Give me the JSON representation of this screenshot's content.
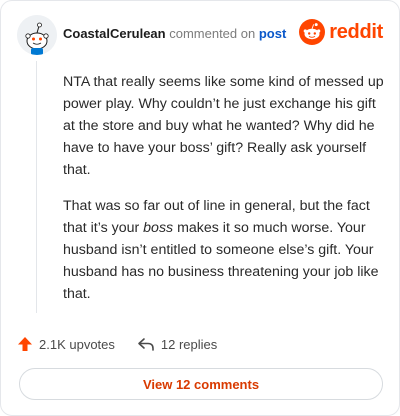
{
  "header": {
    "username": "CoastalCerulean",
    "commented_on": "commented on",
    "post_link": "post"
  },
  "brand": {
    "name": "reddit",
    "color": "#ff4500"
  },
  "comment": {
    "paragraph1": "NTA that really seems like some kind of messed up power play. Why couldn’t he just exchange his gift at the store and buy what he wanted? Why did he have to have your boss’ gift? Really ask yourself that.",
    "paragraph2_before": "That was so far out of line in general, but the fact that it’s your ",
    "paragraph2_emphasis": "boss",
    "paragraph2_after": " makes it so much worse. Your husband isn’t entitled to someone else’s gift. Your husband has no business threatening your job like that."
  },
  "actions": {
    "upvotes": "2.1K upvotes",
    "replies": "12 replies",
    "upvote_icon": "upvote-arrow-icon",
    "reply_icon": "reply-arrow-icon"
  },
  "view_comments_label": "View 12 comments",
  "colors": {
    "accent": "#d93a00",
    "link": "#0a58ca",
    "upvote": "#ff4500"
  }
}
